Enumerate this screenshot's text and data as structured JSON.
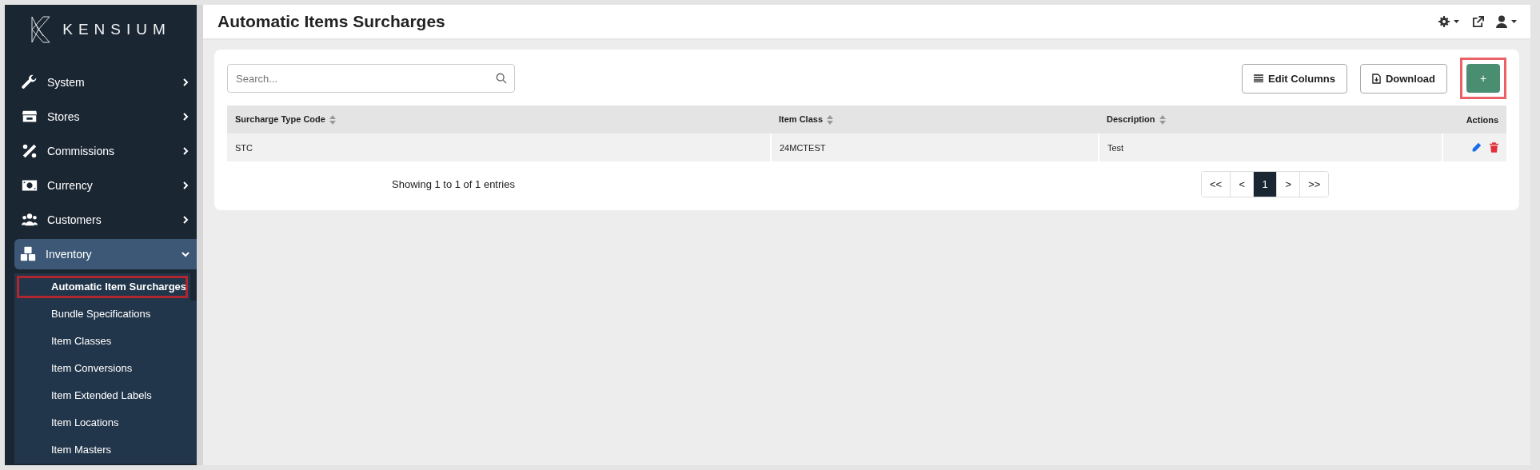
{
  "sidebar": {
    "logo": "KENSIUM",
    "items": [
      {
        "label": "System",
        "kind": "wrench",
        "expanded": false
      },
      {
        "label": "Stores",
        "kind": "store",
        "expanded": false
      },
      {
        "label": "Commissions",
        "kind": "percent",
        "expanded": false
      },
      {
        "label": "Currency",
        "kind": "money",
        "expanded": false
      },
      {
        "label": "Customers",
        "kind": "users",
        "expanded": false
      },
      {
        "label": "Inventory",
        "kind": "boxes",
        "expanded": true,
        "children": [
          {
            "label": "Automatic Item Surcharges",
            "selected": true,
            "highlighted": true
          },
          {
            "label": "Bundle Specifications",
            "selected": false,
            "highlighted": false
          },
          {
            "label": "Item Classes",
            "selected": false,
            "highlighted": false
          },
          {
            "label": "Item Conversions",
            "selected": false,
            "highlighted": false
          },
          {
            "label": "Item Extended Labels",
            "selected": false,
            "highlighted": false
          },
          {
            "label": "Item Locations",
            "selected": false,
            "highlighted": false
          },
          {
            "label": "Item Masters",
            "selected": false,
            "highlighted": false
          }
        ]
      }
    ]
  },
  "page_title": "Automatic Items Surcharges",
  "toolbar": {
    "search": {
      "placeholder": "Search..."
    },
    "buttons": [
      {
        "label": "Edit Columns",
        "kind": "list"
      },
      {
        "label": "Download",
        "kind": "file"
      }
    ],
    "add_button": {
      "label": "+",
      "highlighted": true
    }
  },
  "table": {
    "columns": [
      {
        "label": "Surcharge Type Code",
        "sortable": true
      },
      {
        "label": "Item Class",
        "sortable": true
      },
      {
        "label": "Description",
        "sortable": true
      },
      {
        "label": "Actions",
        "sortable": false
      }
    ],
    "rows": [
      {
        "cells": [
          "STC",
          "24MCTEST",
          "Test"
        ]
      }
    ]
  },
  "footer": {
    "summary": "Showing 1 to 1 of 1 entries",
    "pagination": [
      {
        "label": "<<",
        "selected": false
      },
      {
        "label": "<",
        "selected": false
      },
      {
        "label": "1",
        "selected": true
      },
      {
        "label": ">",
        "selected": false
      },
      {
        "label": ">>",
        "selected": false
      }
    ]
  }
}
